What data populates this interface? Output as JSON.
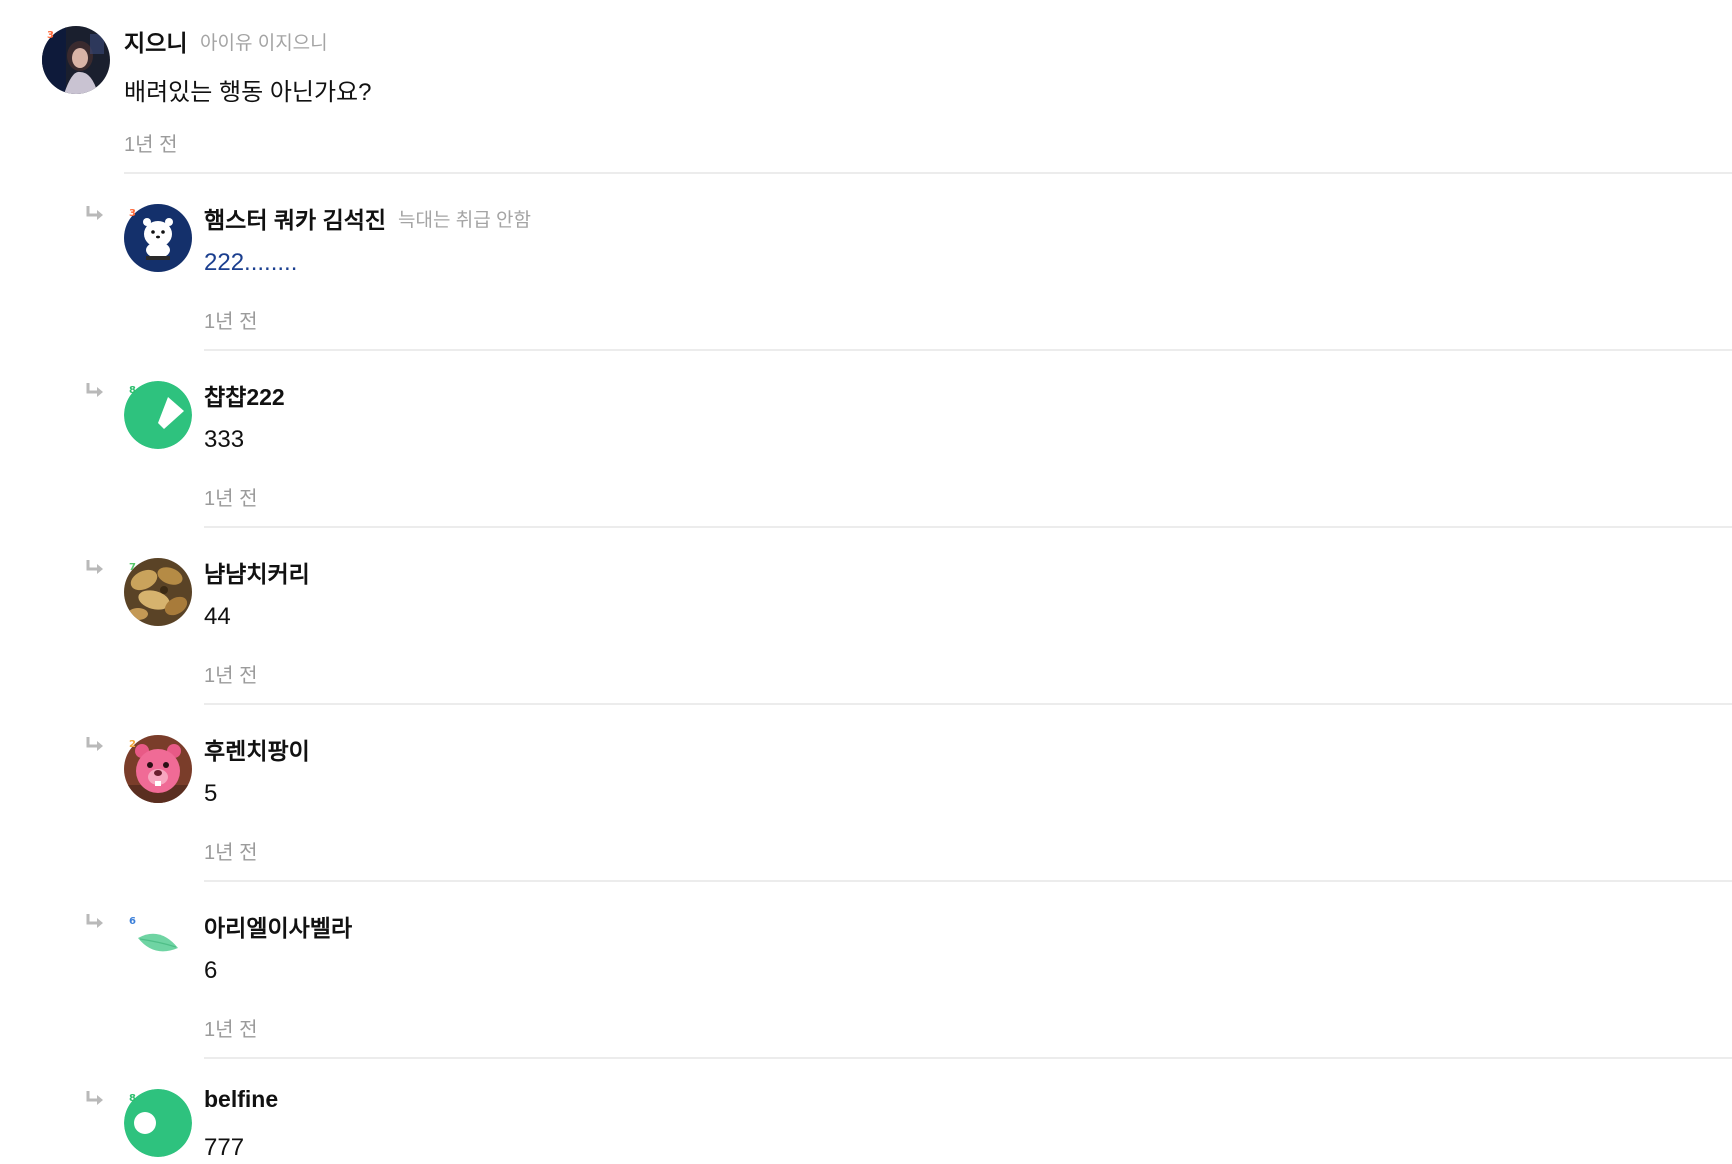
{
  "comments": [
    {
      "nickname": "지으니",
      "subname": "아이유 이지으니",
      "body": "배려있는 행동 아닌가요?",
      "time": "1년 전",
      "level": "3",
      "level_color": "#ff6b3d"
    },
    {
      "nickname": "햄스터 쿼카 김석진",
      "subname": "늑대는 취급 안함",
      "body": "222........",
      "time": "1년 전",
      "level": "3",
      "level_color": "#ff6b3d",
      "body_color": "#1b3f8f"
    },
    {
      "nickname": "챱챱222",
      "body": "333",
      "time": "1년 전",
      "level": "8",
      "level_color": "#2dbf6e"
    },
    {
      "nickname": "냠냠치커리",
      "body": "44",
      "time": "1년 전",
      "level": "7",
      "level_color": "#57c76a"
    },
    {
      "nickname": "후렌치팡이",
      "body": "5",
      "time": "1년 전",
      "level": "2",
      "level_color": "#f2a63b"
    },
    {
      "nickname": "아리엘이사벨라",
      "body": "6",
      "time": "1년 전",
      "level": "6",
      "level_color": "#3b7fd9"
    },
    {
      "nickname": "belfine",
      "body": "777",
      "level": "8",
      "level_color": "#2dbf6e"
    }
  ],
  "icons": {
    "reply": "reply-arrow-icon"
  },
  "colors": {
    "avatar_green": "#2ec27e",
    "avatar_navy": "#14306b",
    "leaf": "#6fd4a3",
    "muted_text": "#9b9b9b",
    "divider": "#ececec"
  }
}
